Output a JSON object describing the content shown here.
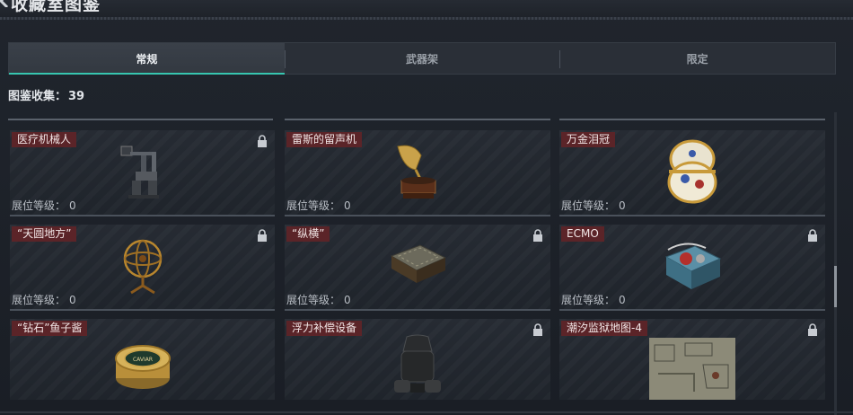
{
  "header": {
    "title": "收藏室图鉴"
  },
  "tabs": [
    {
      "label": "常规",
      "active": true
    },
    {
      "label": "武器架",
      "active": false
    },
    {
      "label": "限定",
      "active": false
    }
  ],
  "collection": {
    "label": "图鉴收集：",
    "count": "39"
  },
  "level_label": "展位等级：",
  "cards": [
    {
      "name": "医疗机械人",
      "level": "0",
      "locked": true,
      "icon": "medical-robot-icon"
    },
    {
      "name": "雷斯的留声机",
      "level": "0",
      "locked": false,
      "icon": "gramophone-icon"
    },
    {
      "name": "万金泪冠",
      "level": "0",
      "locked": false,
      "icon": "jeweled-egg-icon"
    },
    {
      "name": "“天圆地方”",
      "level": "0",
      "locked": true,
      "icon": "armillary-sphere-icon"
    },
    {
      "name": "“纵横”",
      "level": "0",
      "locked": true,
      "icon": "chess-board-icon"
    },
    {
      "name": "ECMO",
      "level": "0",
      "locked": true,
      "icon": "ecmo-machine-icon"
    },
    {
      "name": "“钻石”鱼子酱",
      "level": "",
      "locked": false,
      "icon": "caviar-tin-icon",
      "tin_text": "CAVIAR"
    },
    {
      "name": "浮力补偿设备",
      "level": "",
      "locked": true,
      "icon": "buoyancy-device-icon"
    },
    {
      "name": "潮汐监狱地图-4",
      "level": "",
      "locked": true,
      "icon": "prison-map-icon"
    }
  ],
  "colors": {
    "accent": "#37c6b0",
    "name_tag": "#5b2428",
    "background": "#1b1f26"
  }
}
